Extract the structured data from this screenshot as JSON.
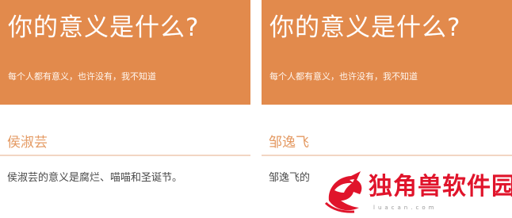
{
  "cards": [
    {
      "header": {
        "title": "你的意义是什么?",
        "subtitle": "每个人都有意义，也许没有，我不知道"
      },
      "name": "侯淑芸",
      "description": "侯淑芸的意义是腐烂、喵喵和圣诞节。"
    },
    {
      "header": {
        "title": "你的意义是什么?",
        "subtitle": "每个人都有意义，也许没有，我不知道"
      },
      "name": "邹逸飞",
      "description": "邹逸飞的"
    }
  ],
  "watermark": {
    "text": "独角兽软件园",
    "domain": "luacan.com",
    "logo": "unicorn-dragon-logo"
  },
  "colors": {
    "header_bg": "#e28a4c",
    "name_text": "#e49a63",
    "divider": "#f2d6c3",
    "watermark_red": "#e0142b"
  }
}
